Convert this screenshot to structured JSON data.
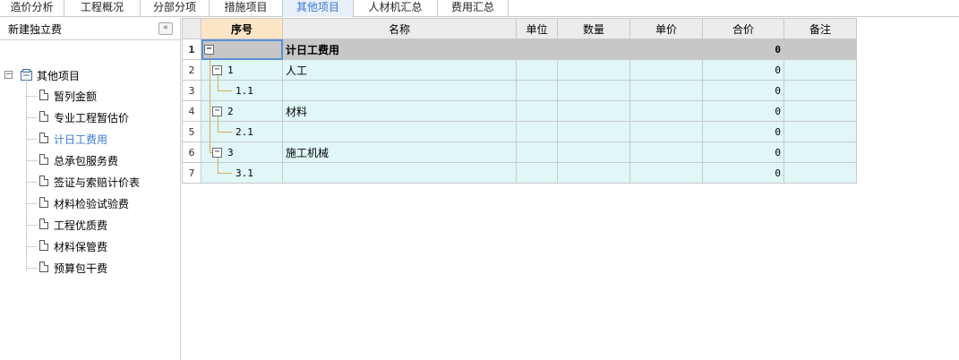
{
  "tabs": [
    {
      "label": "造价分析",
      "active": false
    },
    {
      "label": "工程概况",
      "active": false
    },
    {
      "label": "分部分项",
      "active": false
    },
    {
      "label": "措施项目",
      "active": false
    },
    {
      "label": "其他项目",
      "active": true
    },
    {
      "label": "人材机汇总",
      "active": false
    },
    {
      "label": "费用汇总",
      "active": false
    }
  ],
  "left_panel": {
    "title": "新建独立费",
    "collapse_glyph": "«",
    "root": {
      "label": "其他项目",
      "expander": "−"
    },
    "items": [
      {
        "label": "暂列金额",
        "selected": false
      },
      {
        "label": "专业工程暂估价",
        "selected": false
      },
      {
        "label": "计日工费用",
        "selected": true
      },
      {
        "label": "总承包服务费",
        "selected": false
      },
      {
        "label": "签证与索赔计价表",
        "selected": false
      },
      {
        "label": "材料检验试验费",
        "selected": false
      },
      {
        "label": "工程优质费",
        "selected": false
      },
      {
        "label": "材料保管费",
        "selected": false
      },
      {
        "label": "预算包干费",
        "selected": false
      }
    ]
  },
  "grid": {
    "headers": [
      "",
      "序号",
      "名称",
      "单位",
      "数量",
      "单价",
      "合价",
      "备注"
    ],
    "rows": [
      {
        "row_no": "1",
        "seq": "",
        "name": "计日工费用",
        "unit": "",
        "qty": "",
        "price": "",
        "total": "0",
        "note": "",
        "kind": "top",
        "expander": "−"
      },
      {
        "row_no": "2",
        "seq": "1",
        "name": "人工",
        "unit": "",
        "qty": "",
        "price": "",
        "total": "0",
        "note": "",
        "kind": "group",
        "expander": "−"
      },
      {
        "row_no": "3",
        "seq": "1.1",
        "name": "",
        "unit": "",
        "qty": "",
        "price": "",
        "total": "0",
        "note": "",
        "kind": "leaf"
      },
      {
        "row_no": "4",
        "seq": "2",
        "name": "材料",
        "unit": "",
        "qty": "",
        "price": "",
        "total": "0",
        "note": "",
        "kind": "group",
        "expander": "−"
      },
      {
        "row_no": "5",
        "seq": "2.1",
        "name": "",
        "unit": "",
        "qty": "",
        "price": "",
        "total": "0",
        "note": "",
        "kind": "leaf"
      },
      {
        "row_no": "6",
        "seq": "3",
        "name": "施工机械",
        "unit": "",
        "qty": "",
        "price": "",
        "total": "0",
        "note": "",
        "kind": "group",
        "expander": "−"
      },
      {
        "row_no": "7",
        "seq": "3.1",
        "name": "",
        "unit": "",
        "qty": "",
        "price": "",
        "total": "0",
        "note": "",
        "kind": "leaf"
      }
    ]
  },
  "colors": {
    "accent": "#3a78d4",
    "header_highlight": "#fde6c6",
    "summary_row": "#c7c7c7",
    "detail_row": "#e0f6f7",
    "tree_line": "#d8a857"
  },
  "icons": {
    "root_icon": "folder-icon",
    "item_icon": "document-icon",
    "expander_icon": "minus-box-icon",
    "collapse_icon": "double-chevron-left-icon"
  }
}
